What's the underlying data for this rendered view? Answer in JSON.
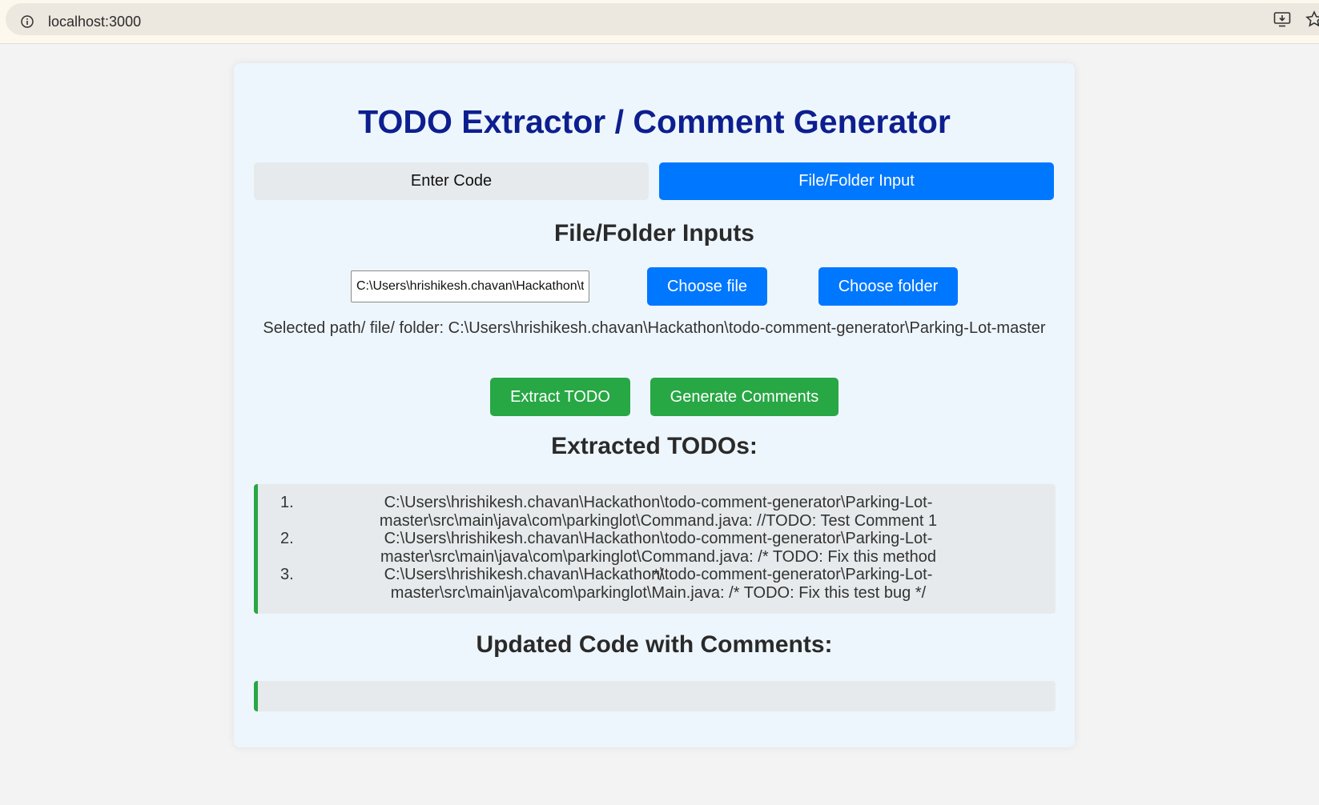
{
  "browser": {
    "url": "localhost:3000"
  },
  "app": {
    "title": "TODO Extractor / Comment Generator",
    "tabs": [
      {
        "label": "Enter Code",
        "active": false
      },
      {
        "label": "File/Folder Input",
        "active": true
      }
    ]
  },
  "file_inputs": {
    "heading": "File/Folder Inputs",
    "path_value": "C:\\Users\\hrishikesh.chavan\\Hackathon\\todo-comment-generator\\Parking-Lot-master",
    "choose_file_label": "Choose file",
    "choose_folder_label": "Choose folder",
    "selected_path_text": "Selected path/ file/ folder: C:\\Users\\hrishikesh.chavan\\Hackathon\\todo-comment-generator\\Parking-Lot-master"
  },
  "actions": {
    "extract_label": "Extract TODO",
    "generate_label": "Generate Comments"
  },
  "todos": {
    "heading": "Extracted TODOs:",
    "items": [
      {
        "num": "1.",
        "text": "C:\\Users\\hrishikesh.chavan\\Hackathon\\todo-comment-generator\\Parking-Lot-master\\src\\main\\java\\com\\parkinglot\\Command.java: //TODO: Test Comment 1"
      },
      {
        "num": "2.",
        "text": "C:\\Users\\hrishikesh.chavan\\Hackathon\\todo-comment-generator\\Parking-Lot-master\\src\\main\\java\\com\\parkinglot\\Command.java: /* TODO: Fix this method */"
      },
      {
        "num": "3.",
        "text": "C:\\Users\\hrishikesh.chavan\\Hackathon\\todo-comment-generator\\Parking-Lot-master\\src\\main\\java\\com\\parkinglot\\Main.java: /* TODO: Fix this test bug */"
      }
    ]
  },
  "updated": {
    "heading": "Updated Code with Comments:",
    "content": ""
  },
  "colors": {
    "title": "#0d1f8f",
    "primary": "#0077ff",
    "success": "#28a745",
    "card_bg": "#eef6fd"
  }
}
